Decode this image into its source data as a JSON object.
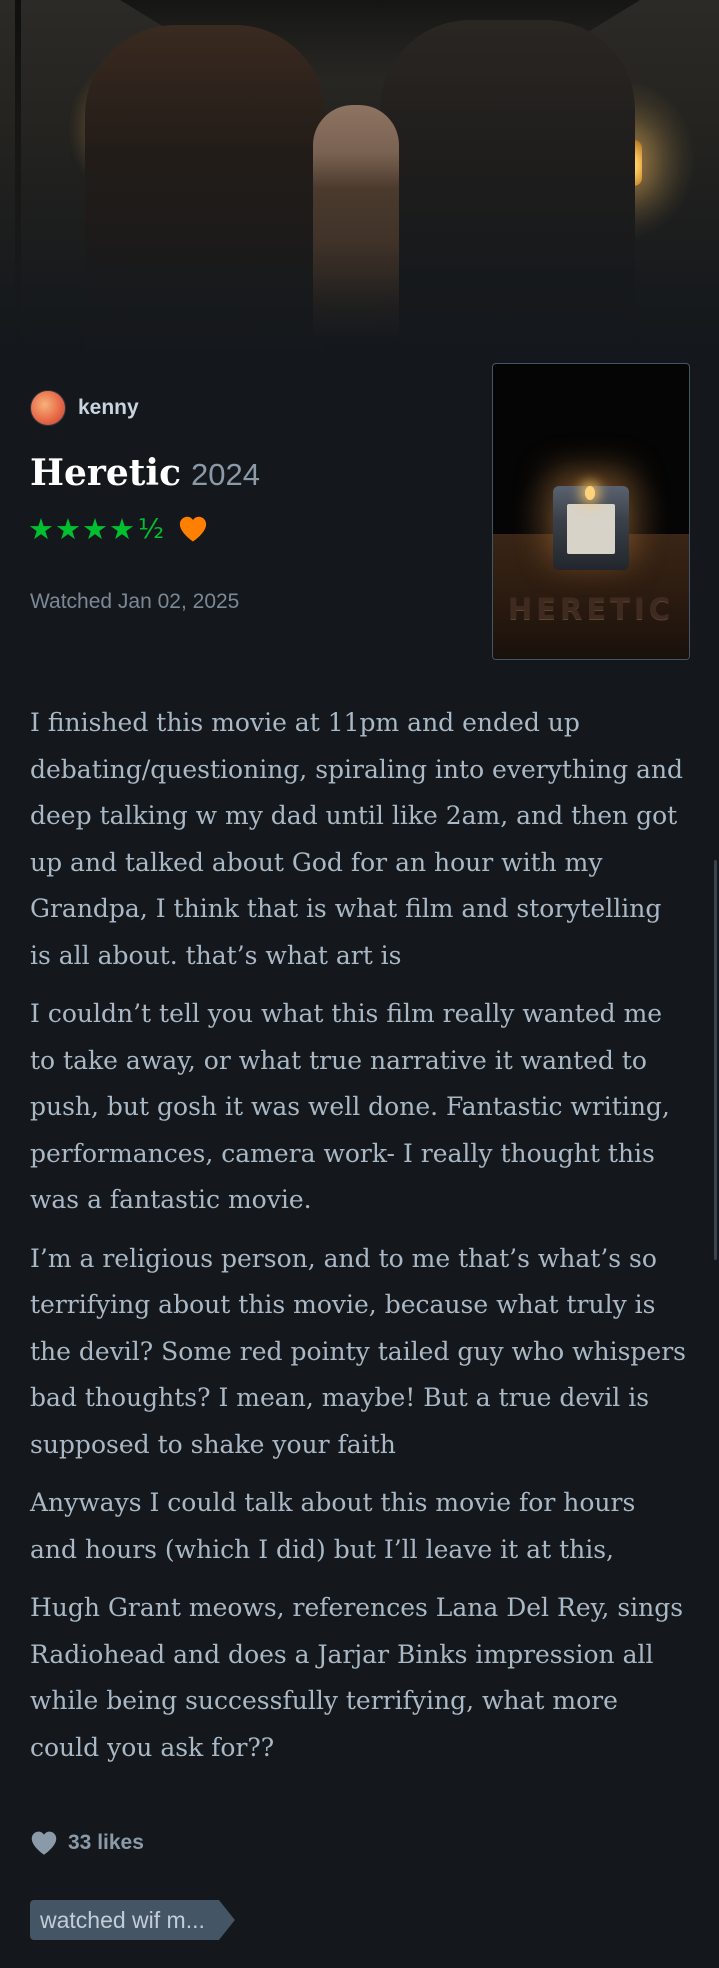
{
  "author": {
    "name": "kenny"
  },
  "film": {
    "title": "Heretic",
    "year": "2024",
    "poster_title": "HERETIC"
  },
  "rating": {
    "stars": "★★★★",
    "half": "½",
    "value": 4.5,
    "max": 5,
    "liked": true,
    "star_color": "#00c030",
    "heart_color": "#ff8000"
  },
  "watched_label": "Watched Jan 02, 2025",
  "review": {
    "paragraphs": [
      "I finished this movie at 11pm and ended up debating/questioning, spiraling into everything and deep talking w my dad until like 2am, and then got up and talked about God for an hour with my Grandpa, I think that is what film and storytelling is all about. that’s what art is",
      "I couldn’t tell you what this film really wanted me to take away, or what true narrative it wanted to push, but gosh it was well done. Fantastic writing, performances, camera work- I really thought this was a fantastic movie.",
      "I’m a religious person, and to me that’s what’s so terrifying about this movie, because what truly is the devil? Some red pointy tailed guy who whispers bad thoughts? I mean, maybe! But a true devil is supposed to shake your faith",
      "Anyways I could talk about this movie for hours and hours (which I did) but I’ll leave it at this,",
      "Hugh Grant meows, references Lana Del Rey, sings Radiohead and does a Jarjar Binks impression all while being successfully terrifying, what more could you ask for??"
    ]
  },
  "likes": {
    "label": "33 likes"
  },
  "tags": [
    "watched wif m..."
  ],
  "icons": {
    "like": "heart-icon",
    "liked": "heart-filled-icon",
    "star": "star-icon"
  },
  "colors": {
    "background": "#14181c",
    "text": "#aab8c5",
    "tag_bg": "#445566"
  }
}
